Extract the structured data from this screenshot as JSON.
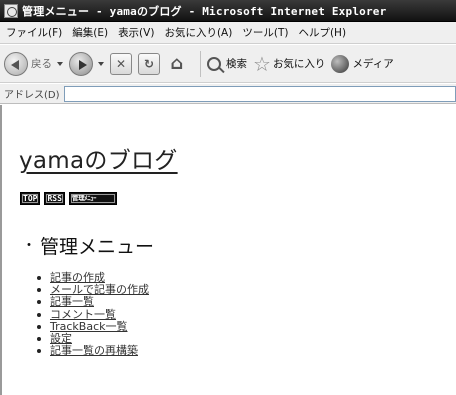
{
  "window": {
    "title": "管理メニュー - yamaのブログ - Microsoft Internet Explorer",
    "app_icon": "ie-page-icon"
  },
  "menubar": {
    "items": [
      {
        "label": "ファイル(F)"
      },
      {
        "label": "編集(E)"
      },
      {
        "label": "表示(V)"
      },
      {
        "label": "お気に入り(A)"
      },
      {
        "label": "ツール(T)"
      },
      {
        "label": "ヘルプ(H)"
      }
    ]
  },
  "toolbar": {
    "back_label": "戻る",
    "search_label": "検索",
    "favorites_label": "お気に入り",
    "media_label": "メディア",
    "icons": {
      "back": "back-arrow-icon",
      "forward": "forward-arrow-icon",
      "stop": "stop-icon",
      "refresh": "refresh-icon",
      "home": "home-icon",
      "search": "search-icon",
      "favorites": "star-icon",
      "media": "media-icon"
    }
  },
  "addressbar": {
    "label": "アドレス(D)",
    "value": ""
  },
  "page": {
    "blog_title": "yamaのブログ",
    "badges": [
      {
        "label": "TOP"
      },
      {
        "label": "RSS"
      },
      {
        "label": "管理ﾒﾆｭｰ"
      }
    ],
    "section_bullet": "・",
    "section_title": "管理メニュー",
    "menu_links": [
      {
        "label": "記事の作成"
      },
      {
        "label": "メールで記事の作成"
      },
      {
        "label": "記事一覧"
      },
      {
        "label": "コメント一覧"
      },
      {
        "label": "TrackBack一覧"
      },
      {
        "label": "設定"
      },
      {
        "label": "記事一覧の再構築"
      }
    ]
  }
}
